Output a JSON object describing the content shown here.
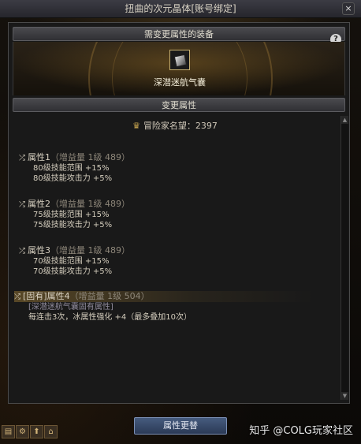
{
  "window": {
    "title": "扭曲的次元晶体[账号绑定]",
    "close_label": "×"
  },
  "equip_section": {
    "header": "需变更属性的装备",
    "help_label": "?",
    "item_name": "深潜迷航气囊"
  },
  "change_section": {
    "header": "变更属性",
    "reputation": "冒险家名望：2397"
  },
  "attributes": [
    {
      "title": "属性1",
      "meta": "（增益量 1级 489）",
      "lines": [
        "80级技能范围 +15%",
        "80级技能攻击力 +5%"
      ]
    },
    {
      "title": "属性2",
      "meta": "（增益量 1级 489）",
      "lines": [
        "75级技能范围 +15%",
        "75级技能攻击力 +5%"
      ]
    },
    {
      "title": "属性3",
      "meta": "（增益量 1级 489）",
      "lines": [
        "70级技能范围 +15%",
        "70级技能攻击力 +5%"
      ]
    },
    {
      "title": "[固有]属性4",
      "meta": "（增益量 1级 504）",
      "lines": [
        "[深潜迷航气囊固有属性]",
        "每连击3次，冰属性强化 +4（最多叠加10次）"
      ]
    }
  ],
  "footer": {
    "apply_button": "属性更替"
  },
  "watermark": "知乎 @COLG玩家社区",
  "colors": {
    "accent_gold": "#c9a650",
    "button_blue": "#465b7e"
  }
}
